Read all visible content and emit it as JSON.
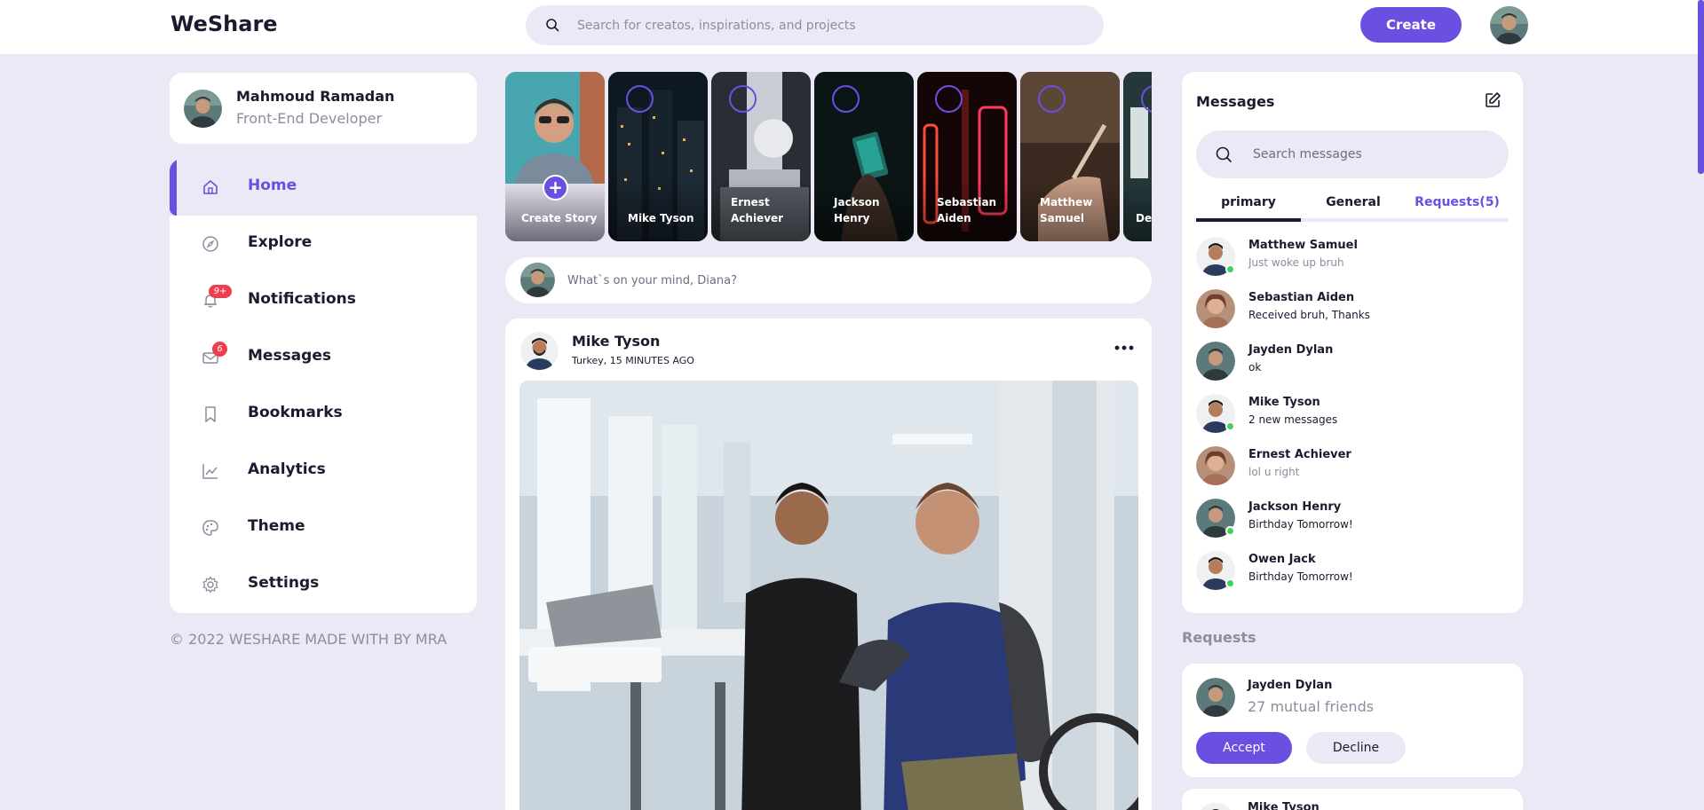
{
  "app": {
    "logo": "WeShare"
  },
  "header": {
    "search_placeholder": "Search for creatos, inspirations, and projects",
    "create_label": "Create"
  },
  "profile": {
    "name": "Mahmoud Ramadan",
    "role": "Front-End Developer"
  },
  "sidebar": {
    "items": [
      {
        "label": "Home",
        "icon": "home-icon",
        "active": true
      },
      {
        "label": "Explore",
        "icon": "compass-icon"
      },
      {
        "label": "Notifications",
        "icon": "bell-icon",
        "badge": "9+"
      },
      {
        "label": "Messages",
        "icon": "envelope-icon",
        "badge": "6"
      },
      {
        "label": "Bookmarks",
        "icon": "bookmark-icon"
      },
      {
        "label": "Analytics",
        "icon": "chart-line-icon"
      },
      {
        "label": "Theme",
        "icon": "palette-icon"
      },
      {
        "label": "Settings",
        "icon": "gear-icon"
      }
    ]
  },
  "footer": {
    "copyright": "© 2022 WESHARE MADE WITH BY MRA"
  },
  "stories": {
    "create_label": "Create Story",
    "items": [
      {
        "name_line1": "Mike Tyson",
        "name_line2": ""
      },
      {
        "name_line1": "Ernest",
        "name_line2": "Achiever"
      },
      {
        "name_line1": "Jackson",
        "name_line2": "Henry"
      },
      {
        "name_line1": "Sebastian",
        "name_line2": "Aiden"
      },
      {
        "name_line1": "Matthew",
        "name_line2": "Samuel"
      },
      {
        "name_line1": "De",
        "name_line2": ""
      }
    ]
  },
  "composer": {
    "placeholder": "What`s on your mind, Diana?"
  },
  "post": {
    "author": "Mike Tyson",
    "meta": "Turkey, 15 MINUTES AGO"
  },
  "messages": {
    "title": "Messages",
    "search_placeholder": "Search messages",
    "tabs": [
      "primary",
      "General",
      "Requests(5)"
    ],
    "items": [
      {
        "name": "Matthew Samuel",
        "text": "Just woke up bruh",
        "online": true,
        "muted": true
      },
      {
        "name": "Sebastian Aiden",
        "text": "Received bruh, Thanks",
        "online": false,
        "muted": false
      },
      {
        "name": "Jayden Dylan",
        "text": "ok",
        "online": false,
        "muted": false
      },
      {
        "name": "Mike Tyson",
        "text": "2 new messages",
        "online": true,
        "muted": false
      },
      {
        "name": "Ernest Achiever",
        "text": "lol u right",
        "online": false,
        "muted": true
      },
      {
        "name": "Jackson Henry",
        "text": "Birthday Tomorrow!",
        "online": true,
        "muted": false
      },
      {
        "name": "Owen Jack",
        "text": "Birthday Tomorrow!",
        "online": true,
        "muted": false
      }
    ]
  },
  "requests": {
    "title": "Requests",
    "items": [
      {
        "name": "Jayden Dylan",
        "mutual": "27 mutual friends",
        "accept": "Accept",
        "decline": "Decline"
      },
      {
        "name": "Mike Tyson"
      }
    ]
  },
  "colors": {
    "accent": "#6b4fe0",
    "background": "#ebe9f5",
    "badge": "#ee3d4e",
    "online": "#3cd35b"
  }
}
